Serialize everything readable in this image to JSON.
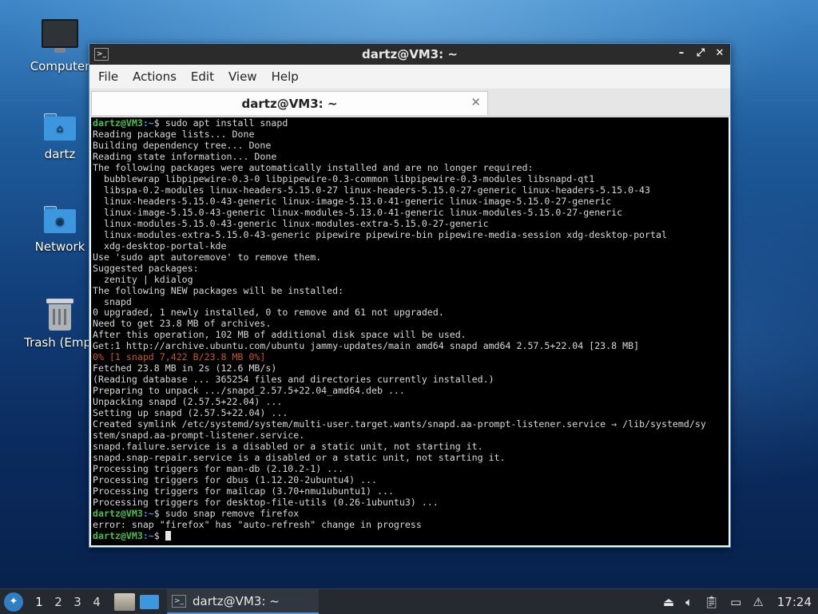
{
  "desktop": {
    "icons": [
      {
        "label": "Computer",
        "icon": "computer-icon"
      },
      {
        "label": "dartz",
        "icon": "home-folder-icon"
      },
      {
        "label": "Network",
        "icon": "network-folder-icon"
      },
      {
        "label": "Trash (Empt",
        "icon": "trash-icon"
      }
    ]
  },
  "window": {
    "title": "dartz@VM3: ~",
    "menu": [
      "File",
      "Edit",
      "View",
      "Help",
      "Actions"
    ],
    "menu_order": [
      "File",
      "Actions",
      "Edit",
      "View",
      "Help"
    ],
    "tab_title": "dartz@VM3: ~"
  },
  "terminal": {
    "prompt_user": "dartz@VM3",
    "prompt_path": ":~",
    "prompt_symbol": "$",
    "lines": [
      {
        "type": "prompt",
        "cmd": " sudo apt install snapd"
      },
      {
        "type": "out",
        "text": "Reading package lists... Done"
      },
      {
        "type": "out",
        "text": "Building dependency tree... Done"
      },
      {
        "type": "out",
        "text": "Reading state information... Done"
      },
      {
        "type": "out",
        "text": "The following packages were automatically installed and are no longer required:"
      },
      {
        "type": "out",
        "text": "  bubblewrap libpipewire-0.3-0 libpipewire-0.3-common libpipewire-0.3-modules libsnapd-qt1"
      },
      {
        "type": "out",
        "text": "  libspa-0.2-modules linux-headers-5.15.0-27 linux-headers-5.15.0-27-generic linux-headers-5.15.0-43"
      },
      {
        "type": "out",
        "text": "  linux-headers-5.15.0-43-generic linux-image-5.13.0-41-generic linux-image-5.15.0-27-generic"
      },
      {
        "type": "out",
        "text": "  linux-image-5.15.0-43-generic linux-modules-5.13.0-41-generic linux-modules-5.15.0-27-generic"
      },
      {
        "type": "out",
        "text": "  linux-modules-5.15.0-43-generic linux-modules-extra-5.15.0-27-generic"
      },
      {
        "type": "out",
        "text": "  linux-modules-extra-5.15.0-43-generic pipewire pipewire-bin pipewire-media-session xdg-desktop-portal"
      },
      {
        "type": "out",
        "text": "  xdg-desktop-portal-kde"
      },
      {
        "type": "out",
        "text": "Use 'sudo apt autoremove' to remove them."
      },
      {
        "type": "out",
        "text": "Suggested packages:"
      },
      {
        "type": "out",
        "text": "  zenity | kdialog"
      },
      {
        "type": "out",
        "text": "The following NEW packages will be installed:"
      },
      {
        "type": "out",
        "text": "  snapd"
      },
      {
        "type": "out",
        "text": "0 upgraded, 1 newly installed, 0 to remove and 61 not upgraded."
      },
      {
        "type": "out",
        "text": "Need to get 23.8 MB of archives."
      },
      {
        "type": "out",
        "text": "After this operation, 102 MB of additional disk space will be used."
      },
      {
        "type": "out",
        "text": "Get:1 http://archive.ubuntu.com/ubuntu jammy-updates/main amd64 snapd amd64 2.57.5+22.04 [23.8 MB]"
      },
      {
        "type": "warn",
        "text": "0% [1 snapd 7,422 B/23.8 MB 0%]"
      },
      {
        "type": "out",
        "text": "Fetched 23.8 MB in 2s (12.6 MB/s)"
      },
      {
        "type": "out",
        "text": "(Reading database ... 365254 files and directories currently installed.)"
      },
      {
        "type": "out",
        "text": "Preparing to unpack .../snapd_2.57.5+22.04_amd64.deb ..."
      },
      {
        "type": "out",
        "text": "Unpacking snapd (2.57.5+22.04) ..."
      },
      {
        "type": "out",
        "text": "Setting up snapd (2.57.5+22.04) ..."
      },
      {
        "type": "out",
        "text": "Created symlink /etc/systemd/system/multi-user.target.wants/snapd.aa-prompt-listener.service → /lib/systemd/sy"
      },
      {
        "type": "out",
        "text": "stem/snapd.aa-prompt-listener.service."
      },
      {
        "type": "out",
        "text": "snapd.failure.service is a disabled or a static unit, not starting it."
      },
      {
        "type": "out",
        "text": "snapd.snap-repair.service is a disabled or a static unit, not starting it."
      },
      {
        "type": "out",
        "text": "Processing triggers for man-db (2.10.2-1) ..."
      },
      {
        "type": "out",
        "text": "Processing triggers for dbus (1.12.20-2ubuntu4) ..."
      },
      {
        "type": "out",
        "text": "Processing triggers for mailcap (3.70+nmu1ubuntu1) ..."
      },
      {
        "type": "out",
        "text": "Processing triggers for desktop-file-utils (0.26-1ubuntu3) ..."
      },
      {
        "type": "prompt",
        "cmd": " sudo snap remove firefox"
      },
      {
        "type": "out",
        "text": "error: snap \"firefox\" has \"auto-refresh\" change in progress"
      },
      {
        "type": "prompt",
        "cmd": " ",
        "cursor": true
      }
    ]
  },
  "taskbar": {
    "workspaces": [
      "1",
      "2",
      "3",
      "4"
    ],
    "active_workspace": "1",
    "task_label": "dartz@VM3: ~",
    "clock": "17:24"
  },
  "colors": {
    "accent": "#4a90d9",
    "prompt_user": "#48c04a",
    "prompt_path": "#4d8fe0",
    "progress_text": "#c4581e"
  }
}
